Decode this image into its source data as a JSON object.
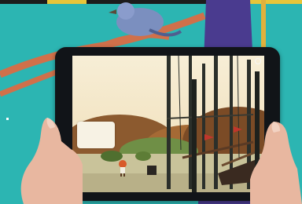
{
  "photo": {
    "subject": "tablet-ar-app",
    "bubble_text": "",
    "colors": {
      "wall": "#2cb5b2",
      "sky": "#f3e7c9",
      "hill": "#8c5a2f",
      "ground": "#c9c39a",
      "bird": "#7b8fbf",
      "branch": "#d0704a",
      "tablet": "#111418",
      "skin": "#e8b7a0"
    }
  }
}
